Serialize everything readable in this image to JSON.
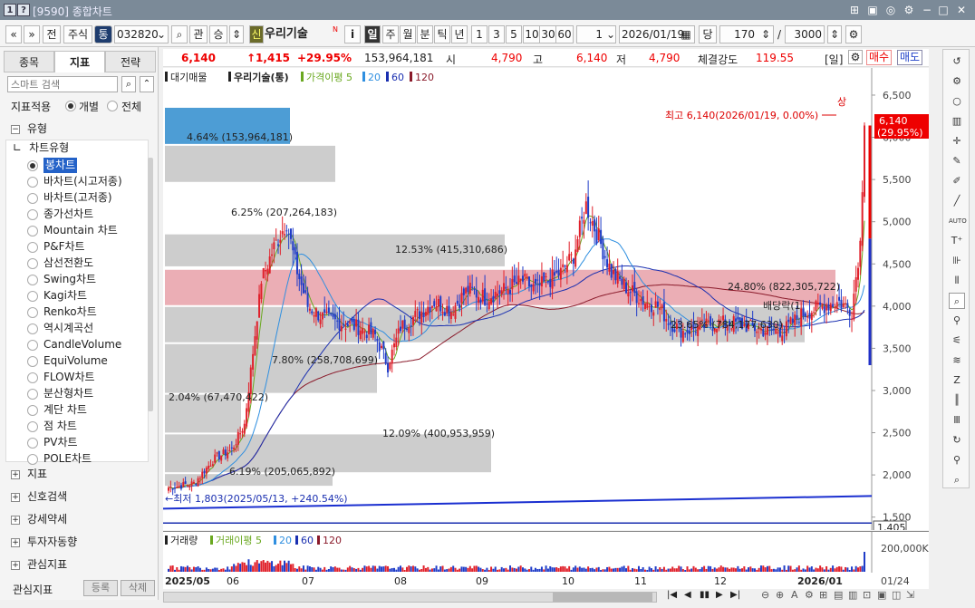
{
  "window": {
    "title": "[9590] 종합차트",
    "help_badges": [
      "1",
      "?"
    ]
  },
  "toolbar": {
    "nav_first": "«",
    "nav_down": "»",
    "btn_jeon": "전",
    "btn_stock": "주식",
    "btn_tong": "통",
    "code": "032820",
    "btn_gwan": "관",
    "btn_seung": "승",
    "badge_sin": "신",
    "company": "우리기술",
    "info_btn": "i",
    "periods": [
      "일",
      "주",
      "월",
      "분",
      "틱",
      "년"
    ],
    "intervals": [
      "1",
      "3",
      "5",
      "10",
      "30",
      "60"
    ],
    "unit": "1",
    "date": "2026/01/19",
    "btn_dang": "당",
    "count": "170",
    "slash": "/",
    "max_count": "3000"
  },
  "left": {
    "tabs": [
      "종목",
      "지표",
      "전략"
    ],
    "search_placeholder": "스마트 검색",
    "apply_label": "지표적용",
    "opt_individual": "개별",
    "opt_all": "전체",
    "type_section": "유형",
    "chart_type_group": "차트유형",
    "chart_types": [
      "봉차트",
      "바차트(시고저종)",
      "바차트(고저종)",
      "종가선차트",
      "Mountain 차트",
      "P&F차트",
      "삼선전환도",
      "Swing차트",
      "Kagi차트",
      "Renko차트",
      "역시계곡선",
      "CandleVolume",
      "EquiVolume",
      "FLOW차트",
      "분산형차트",
      "계단 차트",
      "점 차트",
      "PV차트",
      "POLE차트"
    ],
    "sections": [
      "지표",
      "신호검색",
      "강세약세",
      "투자자동향",
      "관심지표"
    ],
    "footer_label": "관심지표",
    "btn_register": "등록",
    "btn_delete": "삭제"
  },
  "infobar": {
    "price": "6,140",
    "change": "↑1,415",
    "change_pct": "+29.95%",
    "volume": "153,964,181",
    "open_label": "시",
    "open": "4,790",
    "high_label": "고",
    "high": "6,140",
    "low_label": "저",
    "low": "4,790",
    "strength_label": "체결강도",
    "strength": "119.55",
    "period": "[일]",
    "buy": "매수",
    "sell": "매도"
  },
  "chart_data": {
    "type": "candlestick",
    "legend": [
      "대기매물",
      "우리기술(통)",
      "가격이평 5",
      "20",
      "60",
      "120"
    ],
    "colors": {
      "up": "#e0202a",
      "down": "#1f3cc8",
      "ma5": "#6aa820",
      "ma20": "#2f8fe0",
      "ma60": "#1a2fb0",
      "ma120": "#8a1a2a",
      "profile_hi": "#e8a0a8",
      "profile": "#c8c8c8",
      "profile_blue": "#3a92d0"
    },
    "ylim": [
      1400,
      6650
    ],
    "yticks": [
      6500,
      6000,
      5500,
      5000,
      4500,
      4000,
      3500,
      3000,
      2500,
      2000,
      1500
    ],
    "y_labels": [
      "6,500",
      "6,000",
      "5,500",
      "5,000",
      "4,500",
      "4,000",
      "3,500",
      "3,000",
      "2,500",
      "2,000",
      "1,500"
    ],
    "xlabels": [
      "2025/05",
      "06",
      "07",
      "08",
      "09",
      "10",
      "11",
      "12",
      "2026/01"
    ],
    "last_date": "01/24",
    "volume_profile": [
      {
        "lo": 5900,
        "hi": 6350,
        "label": "4.64% (153,964,181)"
      },
      {
        "lo": 5450,
        "hi": 5900,
        "label": "6.25% (207,264,183)"
      },
      {
        "lo": 4450,
        "hi": 4850,
        "label": "12.53% (415,310,686)"
      },
      {
        "lo": 3990,
        "hi": 4430,
        "label": "24.80% (822,305,722)"
      },
      {
        "lo": 3550,
        "hi": 3990,
        "label": "23.65% (784,177,630)"
      },
      {
        "lo": 2950,
        "hi": 3550,
        "label": "7.80% (258,708,699)"
      },
      {
        "lo": 2480,
        "hi": 2950,
        "label": "2.04% (67,470,422)"
      },
      {
        "lo": 2010,
        "hi": 2480,
        "label": "12.09% (400,953,959)"
      },
      {
        "lo": 1850,
        "hi": 2010,
        "label": "6.19% (205,065,892)"
      }
    ],
    "high_note": "최고 6,140(2026/01/19, 0.00%)",
    "low_note": "←최저 1,803(2025/05/13, +240.54%)",
    "limit_up": "상",
    "dividend_note": "배당락(1",
    "current_tag": [
      "6,140",
      "(29.95%)"
    ],
    "bottom_tag": "1,405",
    "volume_legend": [
      "거래량",
      "거래이평 5",
      "20",
      "60",
      "120"
    ],
    "volume_axis": "200,000K"
  },
  "bottom": {
    "controls": [
      "|◀",
      "◀",
      "▮▮",
      "▶",
      "▶|"
    ]
  }
}
